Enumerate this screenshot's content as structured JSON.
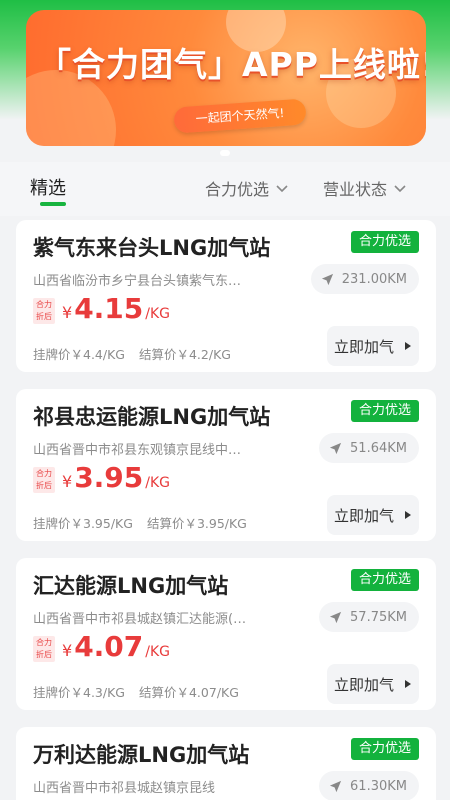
{
  "banner": {
    "title": "「合力团气」APP上线啦!",
    "ribbon": "一起团个天然气!"
  },
  "filters": {
    "selected_tab": "精选",
    "option_1": "合力优选",
    "option_2": "营业状态"
  },
  "colors": {
    "accent_green": "#13b23d",
    "price_red": "#e83b3b"
  },
  "stations": [
    {
      "name": "紫气东来台头LNG加气站",
      "badge": "合力优选",
      "address": "山西省临汾市乡宁县台头镇紫气东…",
      "distance": "231.00KM",
      "tag": "合力折后",
      "currency": "¥",
      "price": "4.15",
      "unit": "/KG",
      "listed_price": "挂牌价￥4.4/KG",
      "settle_price": "结算价￥4.2/KG",
      "action": "立即加气"
    },
    {
      "name": "祁县忠运能源LNG加气站",
      "badge": "合力优选",
      "address": "山西省晋中市祁县东观镇京昆线中…",
      "distance": "51.64KM",
      "tag": "合力折后",
      "currency": "¥",
      "price": "3.95",
      "unit": "/KG",
      "listed_price": "挂牌价￥3.95/KG",
      "settle_price": "结算价￥3.95/KG",
      "action": "立即加气"
    },
    {
      "name": "汇达能源LNG加气站",
      "badge": "合力优选",
      "address": "山西省晋中市祁县城赵镇汇达能源(…",
      "distance": "57.75KM",
      "tag": "合力折后",
      "currency": "¥",
      "price": "4.07",
      "unit": "/KG",
      "listed_price": "挂牌价￥4.3/KG",
      "settle_price": "结算价￥4.07/KG",
      "action": "立即加气"
    },
    {
      "name": "万利达能源LNG加气站",
      "badge": "合力优选",
      "address": "山西省晋中市祁县城赵镇京昆线",
      "distance": "61.30KM"
    }
  ]
}
